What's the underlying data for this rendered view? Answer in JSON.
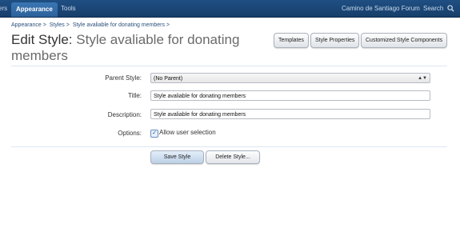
{
  "nav": {
    "left_partial": "ers",
    "tabs": [
      {
        "label": "Appearance",
        "active": true
      },
      {
        "label": "Tools",
        "active": false
      }
    ],
    "forum_link": "Camino de Santiago Forum",
    "search_label": "Search"
  },
  "breadcrumb": [
    {
      "label": "Appearance >"
    },
    {
      "label": "Styles >"
    },
    {
      "label": "Style avaliable for donating members >"
    }
  ],
  "page": {
    "title_prefix": "Edit Style:",
    "title_name": "Style avaliable for donating members"
  },
  "top_buttons": {
    "templates": "Templates",
    "style_properties": "Style Properties",
    "customized_components": "Customized Style Components"
  },
  "form": {
    "parent_style_label": "Parent Style:",
    "parent_style_value": "(No Parent)",
    "title_label": "Title:",
    "title_value": "Style avaliable for donating members",
    "description_label": "Description:",
    "description_value": "Style avaliable for donating members",
    "options_label": "Options:",
    "allow_user_selection_label": "Allow user selection",
    "allow_user_selection_checked": true
  },
  "actions": {
    "save": "Save Style",
    "delete": "Delete Style..."
  }
}
